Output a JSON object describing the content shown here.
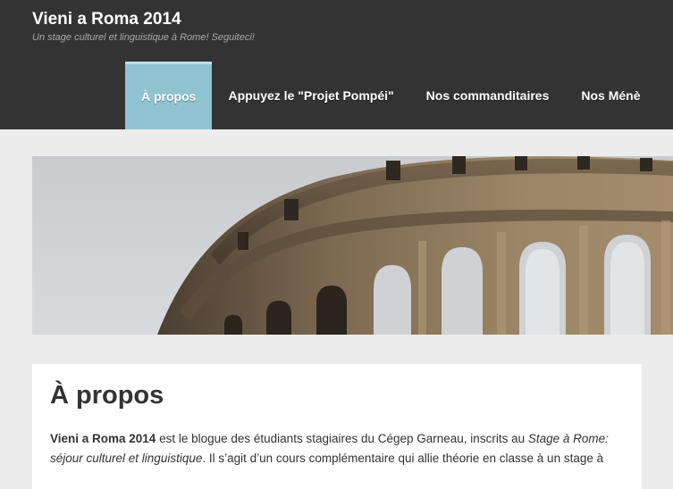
{
  "header": {
    "site_title": "Vieni a Roma 2014",
    "tagline": "Un stage culturel et linguistique à Rome! Seguiteci!"
  },
  "nav": {
    "items": [
      {
        "label": "À propos",
        "active": true
      },
      {
        "label": "Appuyez le \"Projet Pompéi\"",
        "active": false
      },
      {
        "label": "Nos commanditaires",
        "active": false
      },
      {
        "label": "Nos Ménè",
        "active": false
      }
    ]
  },
  "main": {
    "page_title": "À propos",
    "paragraph": {
      "strong_lead": "Vieni a Roma 2014",
      "text_1": " est le blogue des étudiants stagiaires du Cégep Garneau, inscrits au ",
      "italic_course": "Stage à Rome: séjour culturel et linguistique",
      "text_2": ". Il s’agit d’un cours complémentaire qui allie théorie en classe à un stage à"
    }
  },
  "colors": {
    "header_bg": "#333333",
    "nav_active_bg": "#8fc3cf",
    "page_bg": "#ececec"
  }
}
